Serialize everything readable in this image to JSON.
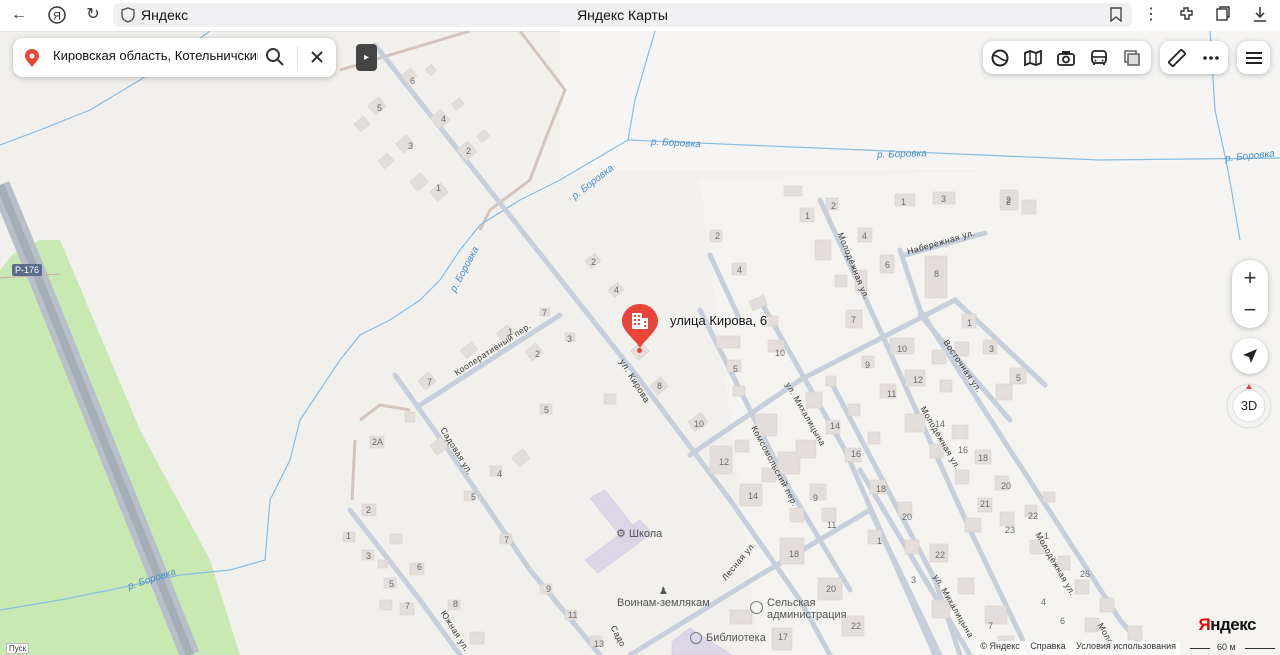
{
  "browser": {
    "omnibox_site": "Яндекс",
    "tab_title": "Яндекс Карты",
    "icons": [
      "back-icon",
      "yandex-icon",
      "reload-icon",
      "shield-icon",
      "bookmark-icon",
      "more-icon",
      "extensions-icon",
      "collections-icon",
      "download-icon"
    ]
  },
  "search": {
    "value": "Кировская область, Котельничский р"
  },
  "controls": {
    "layers": [
      "layers-icon",
      "panorama-icon",
      "camera-icon",
      "transport-icon",
      "offline-icon"
    ],
    "tools": [
      "ruler-icon",
      "more-dots-icon"
    ],
    "zoom_in": "+",
    "zoom_out": "−",
    "view_3d": "3D"
  },
  "marker": {
    "label": "улица Кирова, 6",
    "icon": "building-icon",
    "color": "#e8443a"
  },
  "map": {
    "road_badge": "Р-176",
    "rivers": [
      "р. Боровка",
      "р. Боровка",
      "р. Боровка",
      "р. Боровка",
      "р. Боровка",
      "р. Боровка"
    ],
    "streets": [
      "ул. Кирова",
      "Кооперативный пер.",
      "Садовая ул.",
      "Южная ул.",
      "Садо",
      "Лесная ул.",
      "Комсомольский пер.",
      "ул. Михалицына",
      "ул. Михалицына",
      "Молодёжная ул.",
      "Молодёжная ул.",
      "Молодёжная ул.",
      "Молодёж",
      "Набережная ул.",
      "Восточная ул."
    ],
    "pois": [
      "Школа",
      "Воинам-землякам",
      "Сельская администрация",
      "Библиотека"
    ],
    "house_numbers": [
      "6",
      "5",
      "4",
      "3",
      "2",
      "1",
      "2",
      "4",
      "7",
      "3",
      "2",
      "1",
      "5",
      "7",
      "2А",
      "4",
      "5",
      "6",
      "7",
      "8",
      "9",
      "11",
      "13",
      "2",
      "1",
      "3",
      "5",
      "7",
      "8",
      "10",
      "12",
      "14",
      "18",
      "2",
      "4",
      "5",
      "10",
      "1",
      "2",
      "4",
      "6",
      "7",
      "8",
      "1",
      "3",
      "2",
      "1",
      "3",
      "5",
      "9",
      "11",
      "14",
      "16",
      "18",
      "20",
      "22",
      "9",
      "11",
      "10",
      "12",
      "14",
      "16",
      "18",
      "20",
      "22",
      "26",
      "1",
      "3",
      "21",
      "23",
      "20",
      "22",
      "17",
      "2",
      "4",
      "6",
      "7",
      "1",
      "3"
    ]
  },
  "footer": {
    "copyright": "© Яндекс",
    "help": "Справка",
    "terms": "Условия использования",
    "scale": "60 м",
    "brand_y": "Я",
    "brand_rest": "ндекс",
    "pusk": "Пуск"
  }
}
